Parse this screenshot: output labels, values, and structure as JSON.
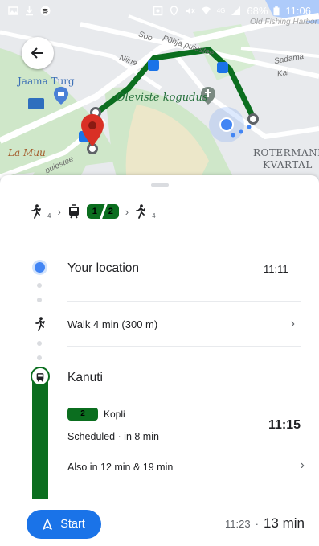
{
  "status_bar": {
    "battery": "68%",
    "time": "11:06",
    "network": "4G"
  },
  "map": {
    "labels": {
      "soo": "Soo",
      "pohja": "Põhja puiestee",
      "niine": "Niine",
      "sadama": "Sadama",
      "kai": "Kai",
      "jaama_turg": "Jaama Turg",
      "oleviste": "Oleviste kogudus",
      "la_muu": "La Muu",
      "rotermann": "ROTERMANN",
      "kvartal": "KVARTAL",
      "puiestee": "puiestee",
      "top_right": "Old Fishing Harbor"
    }
  },
  "summary": {
    "walk_before": "4",
    "transit_lines": [
      "1",
      "2"
    ],
    "walk_after": "4"
  },
  "steps": {
    "origin": {
      "title": "Your location",
      "time": "11:11"
    },
    "walk": {
      "text": "Walk 4 min (300 m)"
    },
    "stop": {
      "title": "Kanuti"
    },
    "route": {
      "number": "2",
      "destination": "Kopli",
      "scheduled": "Scheduled · in 8 min",
      "departure": "11:15",
      "also": "Also in 12 min & 19 min"
    }
  },
  "bottom": {
    "start_label": "Start",
    "arrival": "11:23",
    "separator": "·",
    "duration": "13 min"
  },
  "colors": {
    "route_green": "#0b6e1f",
    "accent_blue": "#1a73e8",
    "pin_red": "#d93025",
    "location_blue": "#4285f4"
  }
}
